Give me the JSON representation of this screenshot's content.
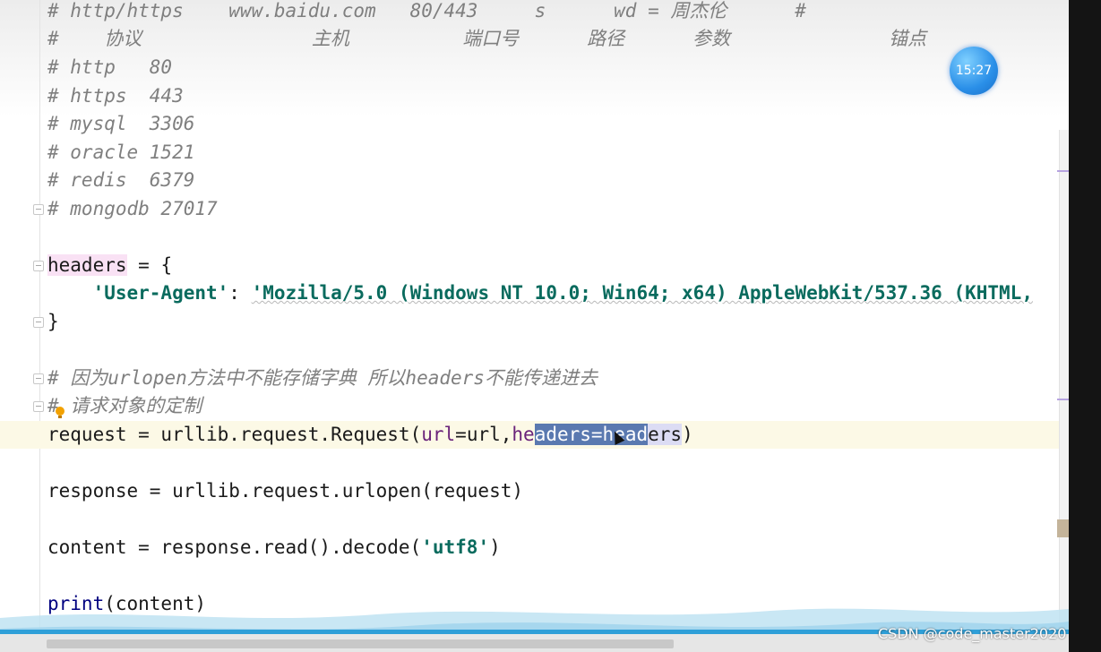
{
  "comments": {
    "url_example": "# http/https    www.baidu.com   80/443     s      wd = 周杰伦      #",
    "url_parts": "#    协议               主机          端口号      路径      参数              锚点",
    "http": "# http   80",
    "https": "# https  443",
    "mysql": "# mysql  3306",
    "oracle": "# oracle 1521",
    "redis": "# redis  6379",
    "mongodb": "# mongodb 27017",
    "reason": "# 因为urlopen方法中不能存储字典 所以headers不能传递进去",
    "customize": "# 请求对象的定制"
  },
  "code": {
    "headers_var": "headers",
    "headers_rest": " = {",
    "ua_indent": "    ",
    "ua_key": "'User-Agent'",
    "ua_colon": ": ",
    "ua_value": "'Mozilla/5.0 (Windows NT 10.0; Win64; x64) AppleWebKit/537.36 (KHTML,",
    "close_brace": "}",
    "request_prefix": "request = urllib.request.Request(",
    "url_kw": "url",
    "url_eq": "=url,",
    "he": "he",
    "sel_text": "aders=head",
    "sel_rest": "ers",
    "close_paren": ")",
    "response_line": "response = urllib.request.urlopen(request)",
    "content_prefix": "content = response.read().decode(",
    "utf8": "'utf8'",
    "content_suffix": ")",
    "print_fn": "print",
    "print_args": "(content)"
  },
  "overlay": {
    "clock": "15:27",
    "watermark": "CSDN @code_master2020"
  },
  "colors": {
    "current_line": "#fcf9e6",
    "selection": "#5a79b0",
    "string": "#0a6b5e",
    "comment": "#7f7f7f",
    "param": "#6a237a"
  }
}
